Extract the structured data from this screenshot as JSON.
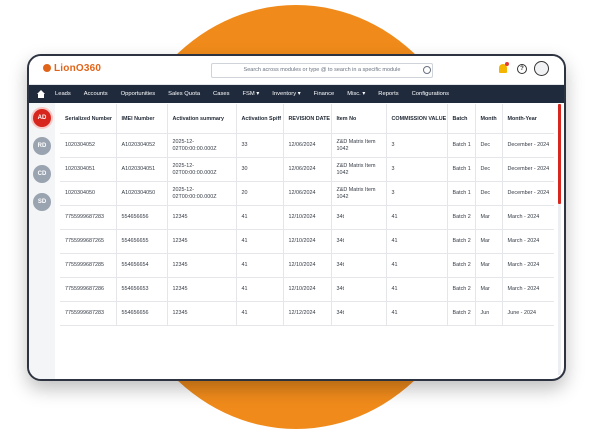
{
  "brand": {
    "logo_text": "LionO360",
    "accent": "#e0651b",
    "nav_bg": "#1f2a3c",
    "alert": "#d7261e"
  },
  "search": {
    "placeholder": "Search across modules or type @ to search in a specific module"
  },
  "header_icons": [
    "info-icon",
    "bell-icon",
    "help-icon",
    "avatar"
  ],
  "nav": {
    "items": [
      "Leads",
      "Accounts",
      "Opportunities",
      "Sales Quota",
      "Cases",
      "FSM ▾",
      "Inventory ▾",
      "Finance",
      "Misc. ▾",
      "Reports",
      "Configurations"
    ]
  },
  "sidebar": {
    "items": [
      "AD",
      "RD",
      "CD",
      "SD"
    ],
    "active": "AD"
  },
  "table": {
    "columns": [
      "Serialized Number",
      "IMEI Number",
      "Activation summary",
      "Activation Spiff",
      "REVISION DATE",
      "Item No",
      "COMMISSION VALUE",
      "Batch",
      "Month",
      "Month-Year"
    ],
    "rows": [
      [
        "1020304052",
        "A1020304052",
        "2025-12-02T00:00:00.000Z",
        "33",
        "12/06/2024",
        "Z&D Matrix Item 1042",
        "3",
        "Batch 1",
        "Dec",
        "December - 2024"
      ],
      [
        "1020304051",
        "A1020304051",
        "2025-12-02T00:00:00.000Z",
        "30",
        "12/06/2024",
        "Z&D Matrix Item 1042",
        "3",
        "Batch 1",
        "Dec",
        "December - 2024"
      ],
      [
        "1020304050",
        "A1020304050",
        "2025-12-02T00:00:00.000Z",
        "20",
        "12/06/2024",
        "Z&D Matrix Item 1042",
        "3",
        "Batch 1",
        "Dec",
        "December - 2024"
      ],
      [
        "7755999687283",
        "554656656",
        "12345",
        "41",
        "12/10/2024",
        "34t",
        "41",
        "Batch 2",
        "Mar",
        "March - 2024"
      ],
      [
        "7755999687265",
        "554656655",
        "12345",
        "41",
        "12/10/2024",
        "34t",
        "41",
        "Batch 2",
        "Mar",
        "March - 2024"
      ],
      [
        "7755999687285",
        "554656654",
        "12345",
        "41",
        "12/10/2024",
        "34t",
        "41",
        "Batch 2",
        "Mar",
        "March - 2024"
      ],
      [
        "7755999687286",
        "554656653",
        "12345",
        "41",
        "12/10/2024",
        "34t",
        "41",
        "Batch 2",
        "Mar",
        "March - 2024"
      ],
      [
        "7755999687283",
        "554656656",
        "12345",
        "41",
        "12/12/2024",
        "34t",
        "41",
        "Batch 2",
        "Jun",
        "June - 2024"
      ]
    ]
  }
}
